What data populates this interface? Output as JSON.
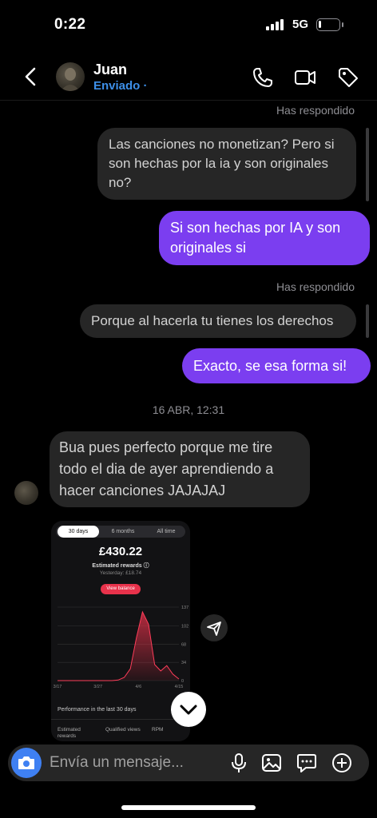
{
  "status_bar": {
    "time": "0:22",
    "network": "5G",
    "battery_level": 0.12
  },
  "header": {
    "contact_name": "Juan",
    "contact_status": "Enviado",
    "status_dot": "·",
    "icons": [
      "back-icon",
      "phone-icon",
      "video-icon",
      "tag-icon"
    ]
  },
  "messages": [
    {
      "kind": "meta",
      "text": "Has respondido"
    },
    {
      "kind": "received",
      "text": "Las canciones no monetizan? Pero si son hechas por la ia y son originales no?"
    },
    {
      "kind": "sent",
      "text": "Si son hechas por IA y son originales si"
    },
    {
      "kind": "meta",
      "text": "Has respondido"
    },
    {
      "kind": "received",
      "text": "Porque al hacerla tu tienes los derechos"
    },
    {
      "kind": "sent",
      "text": "Exacto, se esa forma si!"
    },
    {
      "kind": "date",
      "text": "16 ABR, 12:31"
    },
    {
      "kind": "received",
      "text": "Bua pues perfecto porque me tire todo el dia de ayer aprendiendo a hacer canciones JAJAJAJ"
    }
  ],
  "shared_screenshot": {
    "tabs": [
      "30 days",
      "6 months",
      "All time"
    ],
    "active_tab": "30 days",
    "amount": "£430.22",
    "estimated_label": "Estimated rewards",
    "info_icon": "info-icon",
    "yesterday": "Yesterday: £18.74",
    "view_button": "View balance",
    "performance_label": "Performance in the last 30 days",
    "columns": [
      "Estimated rewards",
      "Qualified views",
      "RPM"
    ],
    "accent_color": "#e8324b"
  },
  "chart_data": {
    "type": "area",
    "x_ticks": [
      "3/17",
      "3/27",
      "4/6",
      "4/15"
    ],
    "y_ticks": [
      "137",
      "102",
      "68",
      "34",
      "0"
    ],
    "ylim": [
      0,
      137
    ],
    "grid": true,
    "series": [
      {
        "x": [
          "3/17",
          "3/19",
          "3/21",
          "3/23",
          "3/25",
          "3/27",
          "3/29",
          "3/31",
          "4/2",
          "4/4",
          "4/5",
          "4/6",
          "4/7",
          "4/8",
          "4/9",
          "4/10",
          "4/11",
          "4/12",
          "4/13",
          "4/14",
          "4/15"
        ],
        "values": [
          0,
          0,
          0,
          0,
          0,
          0,
          0,
          0,
          0,
          0,
          1,
          6,
          22,
          80,
          128,
          105,
          30,
          18,
          28,
          12,
          3
        ]
      }
    ]
  },
  "composer": {
    "placeholder": "Envía un mensaje..."
  }
}
